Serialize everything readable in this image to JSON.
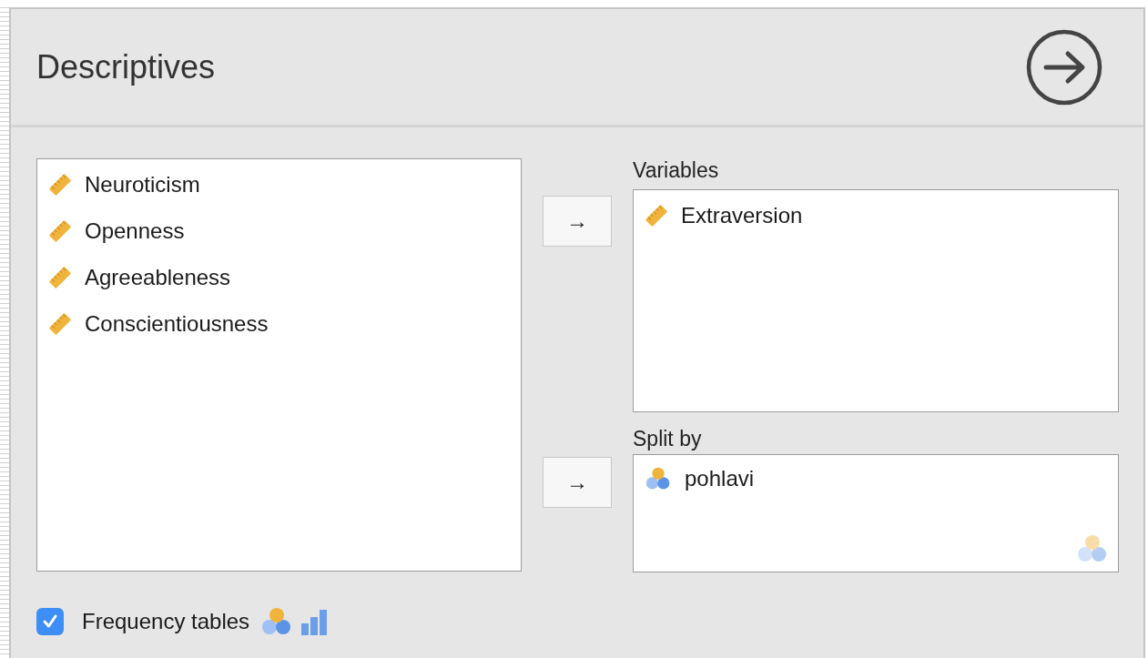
{
  "title": "Descriptives",
  "available_variables": [
    {
      "name": "Neuroticism",
      "kind": "continuous"
    },
    {
      "name": "Openness",
      "kind": "continuous"
    },
    {
      "name": "Agreeableness",
      "kind": "continuous"
    },
    {
      "name": "Conscientiousness",
      "kind": "continuous"
    }
  ],
  "variables": {
    "label": "Variables",
    "arrow": "→",
    "items": [
      {
        "name": "Extraversion",
        "kind": "continuous"
      }
    ]
  },
  "split_by": {
    "label": "Split by",
    "arrow": "→",
    "items": [
      {
        "name": "pohlavi",
        "kind": "nominal"
      }
    ]
  },
  "frequency_tables": {
    "label": "Frequency tables",
    "checked": true
  }
}
